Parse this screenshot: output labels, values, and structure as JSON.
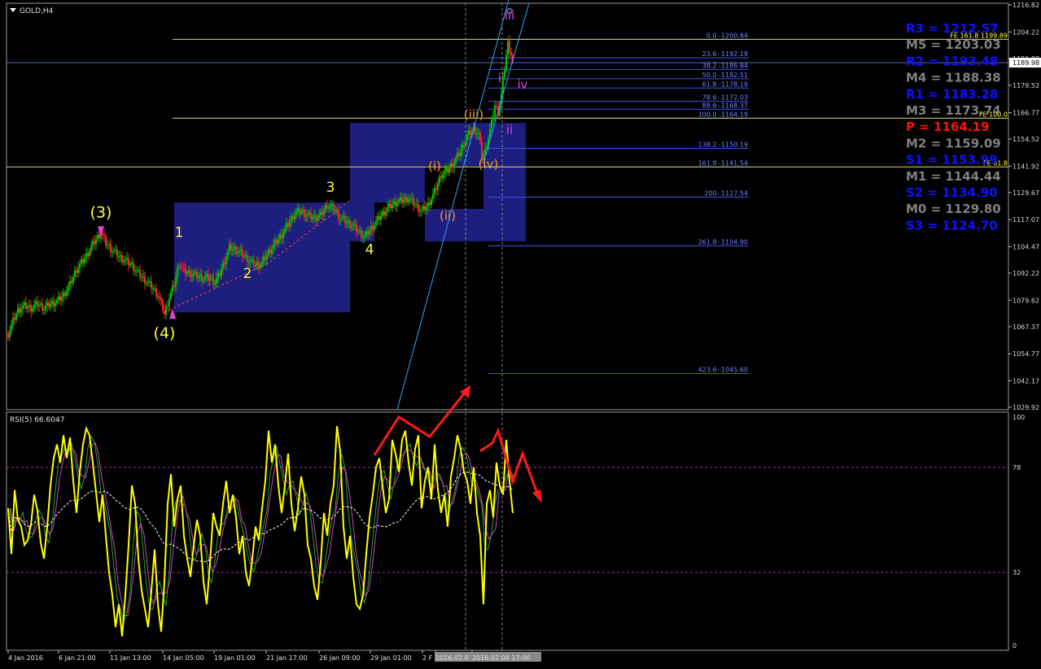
{
  "window": {
    "title": "GOLD,H4",
    "rsi_label": "RSI(5) 66.6047"
  },
  "colors": {
    "background": "#000000",
    "grid": "#2a2a2a",
    "up": "#00c000",
    "down": "#ff2020",
    "fib": "#3a55e8",
    "yellow": "#ffff40",
    "orange": "#ff9a1e",
    "magenta": "#e040e0",
    "box": "#1e1e7e",
    "trend": "#2aa7ff",
    "rsi": "#ffff00",
    "rsi_signal": "#d040d0",
    "rsi_fast": "#22aa22",
    "pivot_r": "#1010ff",
    "pivot_m": "#808080",
    "pivot_p": "#ff1010"
  },
  "chart_data": {
    "type": "candlestick",
    "symbol": "GOLD",
    "timeframe": "H4",
    "ylim": [
      1029.92,
      1216.82
    ],
    "y_ticks": [
      "1216.82",
      "1204.22",
      "1191.88",
      "1179.52",
      "1166.77",
      "1154.52",
      "1141.92",
      "1129.67",
      "1117.07",
      "1104.47",
      "1092.22",
      "1079.62",
      "1067.37",
      "1054.77",
      "1042.17",
      "1029.92"
    ],
    "current_price": "1189.98",
    "x_ticks": [
      "4 Jan 2016",
      "6 Jan 21:00",
      "11 Jan 13:00",
      "14 Jan 05:00",
      "19 Jan 01:00",
      "21 Jan 17:00",
      "26 Jan 09:00",
      "29 Jan 01:00",
      "2 F",
      "2016.02.0",
      "2016.02.08 17:00"
    ],
    "price_series": [
      [
        0,
        1064
      ],
      [
        3,
        1070
      ],
      [
        6,
        1075
      ],
      [
        10,
        1077
      ],
      [
        14,
        1076
      ],
      [
        18,
        1078
      ],
      [
        22,
        1076
      ],
      [
        26,
        1078
      ],
      [
        30,
        1079
      ],
      [
        34,
        1082
      ],
      [
        38,
        1087
      ],
      [
        42,
        1094
      ],
      [
        46,
        1098
      ],
      [
        50,
        1103
      ],
      [
        54,
        1108
      ],
      [
        57,
        1111
      ],
      [
        60,
        1106
      ],
      [
        64,
        1103
      ],
      [
        68,
        1100
      ],
      [
        72,
        1098
      ],
      [
        76,
        1096
      ],
      [
        80,
        1092
      ],
      [
        84,
        1089
      ],
      [
        88,
        1086
      ],
      [
        92,
        1082
      ],
      [
        95,
        1076
      ],
      [
        96,
        1073
      ],
      [
        99,
        1081
      ],
      [
        102,
        1087
      ],
      [
        105,
        1097
      ],
      [
        108,
        1093
      ],
      [
        112,
        1092
      ],
      [
        116,
        1091
      ],
      [
        120,
        1090
      ],
      [
        124,
        1090
      ],
      [
        127,
        1088
      ],
      [
        130,
        1092
      ],
      [
        133,
        1098
      ],
      [
        136,
        1104
      ],
      [
        140,
        1103
      ],
      [
        144,
        1101
      ],
      [
        148,
        1098
      ],
      [
        152,
        1096
      ],
      [
        156,
        1097
      ],
      [
        160,
        1102
      ],
      [
        164,
        1106
      ],
      [
        168,
        1110
      ],
      [
        172,
        1115
      ],
      [
        176,
        1120
      ],
      [
        180,
        1121
      ],
      [
        184,
        1119
      ],
      [
        188,
        1118
      ],
      [
        192,
        1119
      ],
      [
        196,
        1124
      ],
      [
        200,
        1122
      ],
      [
        204,
        1118
      ],
      [
        208,
        1116
      ],
      [
        212,
        1114
      ],
      [
        216,
        1111
      ],
      [
        219,
        1109
      ],
      [
        222,
        1112
      ],
      [
        226,
        1116
      ],
      [
        230,
        1120
      ],
      [
        234,
        1123
      ],
      [
        238,
        1125
      ],
      [
        242,
        1126
      ],
      [
        246,
        1127
      ],
      [
        250,
        1124
      ],
      [
        254,
        1121
      ],
      [
        258,
        1124
      ],
      [
        262,
        1130
      ],
      [
        266,
        1138
      ],
      [
        270,
        1140
      ],
      [
        274,
        1144
      ],
      [
        278,
        1149
      ],
      [
        282,
        1156
      ],
      [
        286,
        1159
      ],
      [
        289,
        1157
      ],
      [
        291,
        1146
      ],
      [
        293,
        1149
      ],
      [
        297,
        1162
      ],
      [
        299,
        1170
      ],
      [
        301,
        1167
      ],
      [
        303,
        1175
      ],
      [
        305,
        1188
      ],
      [
        307,
        1199
      ],
      [
        309,
        1194
      ],
      [
        310,
        1190
      ]
    ],
    "fibonacci_levels": [
      {
        "label": "0.0 -1200.84",
        "price": 1200.84
      },
      {
        "label": "23.6 -1192.19",
        "price": 1192.19
      },
      {
        "label": "38.2 -1186.84",
        "price": 1186.84
      },
      {
        "label": "50.0 -1182.51",
        "price": 1182.51
      },
      {
        "label": "61.8 -1178.19",
        "price": 1178.19
      },
      {
        "label": "78.6 -1172.03",
        "price": 1172.03
      },
      {
        "label": "88.6 -1168.37",
        "price": 1168.37
      },
      {
        "label": "100.0 -1164.19",
        "price": 1164.19
      },
      {
        "label": "138.2 -1150.19",
        "price": 1150.19
      },
      {
        "label": "161.8 -1141.54",
        "price": 1141.54
      },
      {
        "label": "200- 1127.54",
        "price": 1127.54
      },
      {
        "label": "261.8 -1104.90",
        "price": 1104.9
      },
      {
        "label": "423.6 -1045.60",
        "price": 1045.6
      }
    ],
    "fe_levels": [
      {
        "label": "FE 161.8 1199.89",
        "price": 1200.84
      },
      {
        "label": "FE 100.0",
        "price": 1164.19
      },
      {
        "label": "FE 61.8",
        "price": 1141.54
      }
    ],
    "pivots": [
      {
        "label": "R3 = 1212.57",
        "kind": "r"
      },
      {
        "label": "M5 = 1203.03",
        "kind": "m"
      },
      {
        "label": "R2 = 1193.48",
        "kind": "r"
      },
      {
        "label": "M4 = 1188.38",
        "kind": "m"
      },
      {
        "label": "R1 = 1183.28",
        "kind": "r"
      },
      {
        "label": "M3 = 1173.74",
        "kind": "m"
      },
      {
        "label": "P   = 1164.19",
        "kind": "p"
      },
      {
        "label": "M2 = 1159.09",
        "kind": "m"
      },
      {
        "label": "S1 = 1153.99",
        "kind": "r"
      },
      {
        "label": "M1 = 1144.44",
        "kind": "m"
      },
      {
        "label": "S2 = 1134.90",
        "kind": "r"
      },
      {
        "label": "M0 = 1129.80",
        "kind": "m"
      },
      {
        "label": "S3 = 1124.70",
        "kind": "r"
      }
    ],
    "wave_labels": [
      {
        "text": "(3)",
        "bar": 57,
        "price": 1118,
        "color": "yellow"
      },
      {
        "text": "(4)",
        "bar": 96,
        "price": 1062,
        "color": "yellow"
      },
      {
        "text": "1",
        "bar": 105,
        "price": 1109,
        "color": "yellow"
      },
      {
        "text": "2",
        "bar": 147,
        "price": 1090,
        "color": "yellow"
      },
      {
        "text": "3",
        "bar": 198,
        "price": 1130,
        "color": "yellow"
      },
      {
        "text": "4",
        "bar": 222,
        "price": 1101,
        "color": "yellow"
      },
      {
        "text": "(i)",
        "bar": 262,
        "price": 1140,
        "color": "orange"
      },
      {
        "text": "(ii)",
        "bar": 270,
        "price": 1117,
        "color": "orange"
      },
      {
        "text": "(iii)",
        "bar": 286,
        "price": 1164,
        "color": "orange"
      },
      {
        "text": "(iv)",
        "bar": 295,
        "price": 1141,
        "color": "orange"
      },
      {
        "text": "i",
        "bar": 302,
        "price": 1181,
        "color": "magenta"
      },
      {
        "text": "ii",
        "bar": 308,
        "price": 1157,
        "color": "magenta"
      },
      {
        "text": "iii",
        "bar": 308,
        "price": 1210,
        "color": "magenta"
      },
      {
        "text": "iv",
        "bar": 316,
        "price": 1178,
        "color": "magenta"
      }
    ],
    "rsi": {
      "period": 5,
      "value": 66.6047,
      "ylim": [
        0,
        100
      ],
      "tick_labels": [
        "100",
        "78",
        "32",
        "0"
      ],
      "levels": [
        78,
        32
      ],
      "series": [
        [
          0,
          60
        ],
        [
          2,
          40
        ],
        [
          4,
          68
        ],
        [
          6,
          55
        ],
        [
          8,
          52
        ],
        [
          10,
          44
        ],
        [
          12,
          46
        ],
        [
          14,
          53
        ],
        [
          16,
          66
        ],
        [
          18,
          59
        ],
        [
          20,
          45
        ],
        [
          22,
          38
        ],
        [
          24,
          52
        ],
        [
          26,
          70
        ],
        [
          28,
          82
        ],
        [
          30,
          88
        ],
        [
          32,
          80
        ],
        [
          34,
          92
        ],
        [
          36,
          82
        ],
        [
          38,
          91
        ],
        [
          40,
          72
        ],
        [
          42,
          58
        ],
        [
          44,
          76
        ],
        [
          46,
          88
        ],
        [
          48,
          95
        ],
        [
          50,
          92
        ],
        [
          52,
          80
        ],
        [
          54,
          67
        ],
        [
          56,
          54
        ],
        [
          58,
          66
        ],
        [
          60,
          48
        ],
        [
          62,
          32
        ],
        [
          64,
          22
        ],
        [
          66,
          8
        ],
        [
          68,
          18
        ],
        [
          70,
          4
        ],
        [
          72,
          22
        ],
        [
          74,
          44
        ],
        [
          76,
          70
        ],
        [
          78,
          62
        ],
        [
          80,
          38
        ],
        [
          82,
          24
        ],
        [
          84,
          16
        ],
        [
          86,
          8
        ],
        [
          88,
          24
        ],
        [
          90,
          42
        ],
        [
          92,
          18
        ],
        [
          94,
          6
        ],
        [
          96,
          28
        ],
        [
          98,
          62
        ],
        [
          100,
          75
        ],
        [
          102,
          52
        ],
        [
          104,
          64
        ],
        [
          106,
          70
        ],
        [
          108,
          48
        ],
        [
          110,
          38
        ],
        [
          112,
          30
        ],
        [
          114,
          44
        ],
        [
          116,
          55
        ],
        [
          118,
          48
        ],
        [
          120,
          28
        ],
        [
          122,
          18
        ],
        [
          124,
          36
        ],
        [
          126,
          58
        ],
        [
          128,
          52
        ],
        [
          130,
          48
        ],
        [
          132,
          62
        ],
        [
          134,
          72
        ],
        [
          136,
          58
        ],
        [
          138,
          66
        ],
        [
          140,
          56
        ],
        [
          142,
          40
        ],
        [
          144,
          48
        ],
        [
          146,
          32
        ],
        [
          148,
          26
        ],
        [
          150,
          38
        ],
        [
          152,
          52
        ],
        [
          154,
          46
        ],
        [
          156,
          60
        ],
        [
          158,
          72
        ],
        [
          160,
          94
        ],
        [
          162,
          80
        ],
        [
          164,
          88
        ],
        [
          166,
          70
        ],
        [
          168,
          58
        ],
        [
          170,
          70
        ],
        [
          172,
          84
        ],
        [
          174,
          62
        ],
        [
          176,
          50
        ],
        [
          178,
          60
        ],
        [
          180,
          74
        ],
        [
          182,
          66
        ],
        [
          184,
          44
        ],
        [
          186,
          38
        ],
        [
          188,
          26
        ],
        [
          190,
          20
        ],
        [
          192,
          36
        ],
        [
          194,
          58
        ],
        [
          196,
          48
        ],
        [
          198,
          62
        ],
        [
          200,
          70
        ],
        [
          202,
          96
        ],
        [
          204,
          85
        ],
        [
          206,
          52
        ],
        [
          208,
          38
        ],
        [
          210,
          48
        ],
        [
          212,
          30
        ],
        [
          214,
          18
        ],
        [
          216,
          16
        ],
        [
          218,
          22
        ],
        [
          220,
          40
        ],
        [
          222,
          56
        ],
        [
          224,
          66
        ],
        [
          226,
          78
        ],
        [
          228,
          82
        ],
        [
          230,
          70
        ],
        [
          232,
          58
        ],
        [
          234,
          64
        ],
        [
          236,
          90
        ],
        [
          238,
          84
        ],
        [
          240,
          76
        ],
        [
          242,
          90
        ],
        [
          244,
          94
        ],
        [
          246,
          80
        ],
        [
          248,
          70
        ],
        [
          250,
          86
        ],
        [
          252,
          92
        ],
        [
          254,
          60
        ],
        [
          256,
          72
        ],
        [
          258,
          78
        ],
        [
          260,
          64
        ],
        [
          262,
          88
        ],
        [
          264,
          68
        ],
        [
          266,
          58
        ],
        [
          268,
          66
        ],
        [
          270,
          52
        ],
        [
          272,
          74
        ],
        [
          274,
          82
        ],
        [
          276,
          92
        ],
        [
          278,
          86
        ],
        [
          280,
          76
        ],
        [
          282,
          72
        ],
        [
          284,
          62
        ],
        [
          286,
          78
        ],
        [
          288,
          58
        ],
        [
          290,
          48
        ],
        [
          292,
          18
        ],
        [
          294,
          62
        ],
        [
          296,
          68
        ],
        [
          298,
          56
        ],
        [
          300,
          80
        ],
        [
          302,
          70
        ],
        [
          304,
          66
        ],
        [
          306,
          90
        ],
        [
          308,
          72
        ],
        [
          310,
          58
        ]
      ]
    }
  }
}
